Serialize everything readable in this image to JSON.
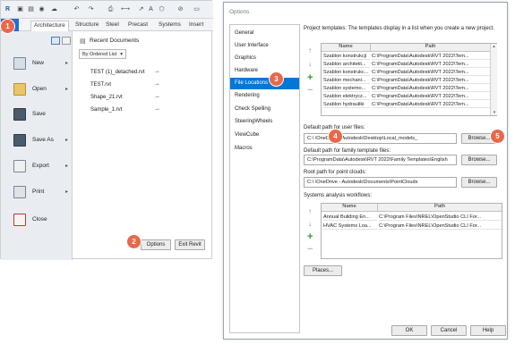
{
  "revit": {
    "ribbon_tabs": [
      "Architecture",
      "Structure",
      "Steel",
      "Precast",
      "Systems",
      "Insert"
    ],
    "active_tab": "Architecture",
    "menu": [
      {
        "label": "New",
        "arrow": "▸"
      },
      {
        "label": "Open",
        "arrow": "▸"
      },
      {
        "label": "Save",
        "arrow": ""
      },
      {
        "label": "Save As",
        "arrow": "▸"
      },
      {
        "label": "Export",
        "arrow": "▸"
      },
      {
        "label": "Print",
        "arrow": "▸"
      },
      {
        "label": "Close",
        "arrow": ""
      }
    ],
    "recent_title": "Recent Documents",
    "sort_label": "By Ordered List",
    "files": [
      "TEST (1)_detached.rvt",
      "TEST.rvt",
      "Shape_21.rvt",
      "Sample_1.rvt"
    ],
    "options_button": "Options",
    "exit_button": "Exit Revit"
  },
  "dialog": {
    "title": "Options",
    "nav": [
      "General",
      "User Interface",
      "Graphics",
      "Hardware",
      "File Locations",
      "Rendering",
      "Check Spelling",
      "SteeringWheels",
      "ViewCube",
      "Macros"
    ],
    "selected_nav": "File Locations",
    "project_templates_label": "Project templates:  The templates display in a list when you create a new project.",
    "templates_columns": [
      "Name",
      "Path"
    ],
    "templates": [
      {
        "name": "Szablon konstrukcji",
        "path": "C:\\ProgramData\\Autodesk\\RVT 2022\\Tem..."
      },
      {
        "name": "Szablon architekt...",
        "path": "C:\\ProgramData\\Autodesk\\RVT 2022\\Tem..."
      },
      {
        "name": "Szablon konstrukc...",
        "path": "C:\\ProgramData\\Autodesk\\RVT 2022\\Tem..."
      },
      {
        "name": "Szablon mechani...",
        "path": "C:\\ProgramData\\Autodesk\\RVT 2022\\Tem..."
      },
      {
        "name": "Szablon systemo...",
        "path": "C:\\ProgramData\\Autodesk\\RVT 2022\\Tem..."
      },
      {
        "name": "Szablon elektrycz...",
        "path": "C:\\ProgramData\\Autodesk\\RVT 2022\\Tem..."
      },
      {
        "name": "Szablon hydrauliki",
        "path": "C:\\ProgramData\\Autodesk\\RVT 2022\\Tem..."
      }
    ],
    "user_files_label": "Default path for user files:",
    "user_files_value": "C:\\         \\OneDrive - Autodesk\\Desktop\\Local_models_",
    "family_label": "Default path for family template files:",
    "family_value": "C:\\ProgramData\\Autodesk\\RVT 2022\\Family Templates\\English",
    "pointcloud_label": "Root path for point clouds:",
    "pointcloud_value": "C:\\                 \\OneDrive - Autodesk\\Documents\\PointClouds",
    "browse": "Browse...",
    "systems_label": "Systems analysis workflows:",
    "systems_columns": [
      "Name",
      "Path"
    ],
    "systems": [
      {
        "name": "Annual Building En...",
        "path": "C:\\Program Files\\NREL\\OpenStudio CLI For..."
      },
      {
        "name": "HVAC Systems Loa...",
        "path": "C:\\Program Files\\NREL\\OpenStudio CLI For..."
      }
    ],
    "places_button": "Places...",
    "ok": "OK",
    "cancel": "Cancel",
    "help": "Help"
  },
  "markers": [
    "1",
    "2",
    "3",
    "4",
    "5"
  ],
  "colors": {
    "accent": "#0078d7",
    "marker": "#e8684a",
    "add": "#2e9e2e"
  }
}
